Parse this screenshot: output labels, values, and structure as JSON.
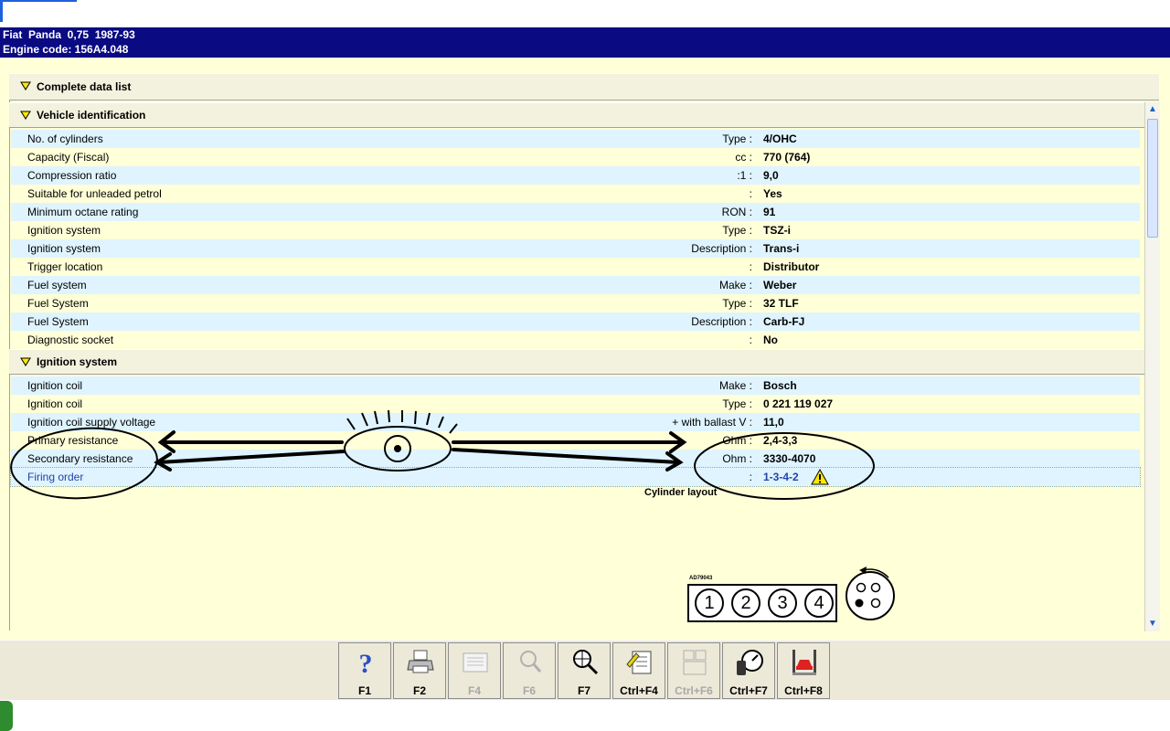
{
  "header": {
    "line1": "Fiat  Panda  0,75  1987-93",
    "line2": "Engine code: 156A4.048"
  },
  "sections": {
    "complete": "Complete data list",
    "vehicle": "Vehicle identification",
    "ignition": "Ignition system"
  },
  "vehicle_rows": [
    {
      "label": "No. of cylinders",
      "unit": "Type :",
      "value": "4/OHC"
    },
    {
      "label": "Capacity (Fiscal)",
      "unit": "cc :",
      "value": "770 (764)"
    },
    {
      "label": "Compression ratio",
      "unit": ":1 :",
      "value": "9,0"
    },
    {
      "label": "Suitable for unleaded petrol",
      "unit": ":",
      "value": "Yes"
    },
    {
      "label": "Minimum octane rating",
      "unit": "RON :",
      "value": "91"
    },
    {
      "label": "Ignition system",
      "unit": "Type :",
      "value": "TSZ-i"
    },
    {
      "label": "Ignition system",
      "unit": "Description :",
      "value": "Trans-i"
    },
    {
      "label": "Trigger location",
      "unit": ":",
      "value": "Distributor"
    },
    {
      "label": "Fuel system",
      "unit": "Make :",
      "value": "Weber"
    },
    {
      "label": "Fuel System",
      "unit": "Type :",
      "value": "32 TLF"
    },
    {
      "label": "Fuel System",
      "unit": "Description :",
      "value": "Carb-FJ"
    },
    {
      "label": "Diagnostic socket",
      "unit": ":",
      "value": "No"
    }
  ],
  "ignition_rows": [
    {
      "label": "Ignition coil",
      "unit": "Make :",
      "value": "Bosch"
    },
    {
      "label": "Ignition coil",
      "unit": "Type :",
      "value": "0 221 119 027"
    },
    {
      "label": "Ignition coil supply voltage",
      "unit": "+ with ballast  V :",
      "value": "11,0"
    },
    {
      "label": "Primary resistance",
      "unit": "Ohm :",
      "value": "2,4-3,3"
    },
    {
      "label": "Secondary resistance",
      "unit": "Ohm :",
      "value": "3330-4070"
    },
    {
      "label": "Firing order",
      "unit": ":",
      "value": "1-3-4-2"
    }
  ],
  "diagram": {
    "title": "Cylinder layout",
    "code": "AD79043",
    "cylinders": [
      "1",
      "2",
      "3",
      "4"
    ]
  },
  "toolbar": [
    {
      "label": "F1",
      "icon": "help-icon",
      "enabled": true
    },
    {
      "label": "F2",
      "icon": "printer-icon",
      "enabled": true
    },
    {
      "label": "F4",
      "icon": "list-icon",
      "enabled": false
    },
    {
      "label": "F6",
      "icon": "search-text-icon",
      "enabled": false
    },
    {
      "label": "F7",
      "icon": "zoom-icon",
      "enabled": true
    },
    {
      "label": "Ctrl+F4",
      "icon": "notes-icon",
      "enabled": true
    },
    {
      "label": "Ctrl+F6",
      "icon": "compare-icon",
      "enabled": false
    },
    {
      "label": "Ctrl+F7",
      "icon": "gauge-icon",
      "enabled": true
    },
    {
      "label": "Ctrl+F8",
      "icon": "car-lift-icon",
      "enabled": true
    }
  ],
  "colors": {
    "header_bg": "#0a0a82",
    "panel_bg": "#ffffd8",
    "row_alt_bg": "#dff4ff",
    "link_text": "#2244aa"
  }
}
